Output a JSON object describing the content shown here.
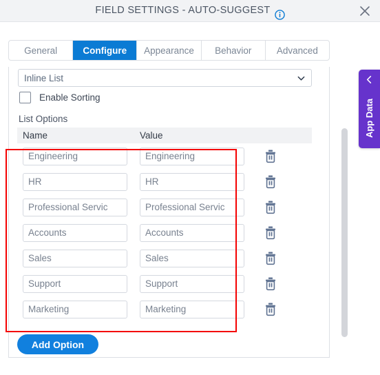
{
  "titlebar": {
    "title": "FIELD SETTINGS - AUTO-SUGGEST",
    "info_icon": "info-circle-icon",
    "close_icon": "close-icon"
  },
  "tabs": [
    {
      "label": "General",
      "active": false
    },
    {
      "label": "Configure",
      "active": true
    },
    {
      "label": "Appearance",
      "active": false
    },
    {
      "label": "Behavior",
      "active": false
    },
    {
      "label": "Advanced",
      "active": false
    }
  ],
  "configure": {
    "list_type_select": {
      "value": "Inline List",
      "icon": "chevron-down-icon"
    },
    "enable_sorting": {
      "label": "Enable Sorting",
      "checked": false
    },
    "list_options_label": "List Options",
    "table": {
      "columns": [
        "Name",
        "Value"
      ],
      "rows": [
        {
          "name": "Engineering",
          "value": "Engineering",
          "delete_icon": "trash-icon"
        },
        {
          "name": "HR",
          "value": "HR",
          "delete_icon": "trash-icon"
        },
        {
          "name": "Professional Servic",
          "value": "Professional Servic",
          "delete_icon": "trash-icon"
        },
        {
          "name": "Accounts",
          "value": "Accounts",
          "delete_icon": "trash-icon"
        },
        {
          "name": "Sales",
          "value": "Sales",
          "delete_icon": "trash-icon"
        },
        {
          "name": "Support",
          "value": "Support",
          "delete_icon": "trash-icon"
        },
        {
          "name": "Marketing",
          "value": "Marketing",
          "delete_icon": "trash-icon"
        }
      ]
    },
    "add_option_label": "Add Option"
  },
  "app_data_tab": {
    "label": "App Data",
    "icon": "chevron-left-icon"
  },
  "colors": {
    "accent_blue": "#0b7bd4",
    "button_blue": "#1180de",
    "purple": "#6633cc",
    "highlight_red": "#f40000",
    "header_bg": "#f2f3f5",
    "table_header_bg": "#f1f2f4"
  }
}
